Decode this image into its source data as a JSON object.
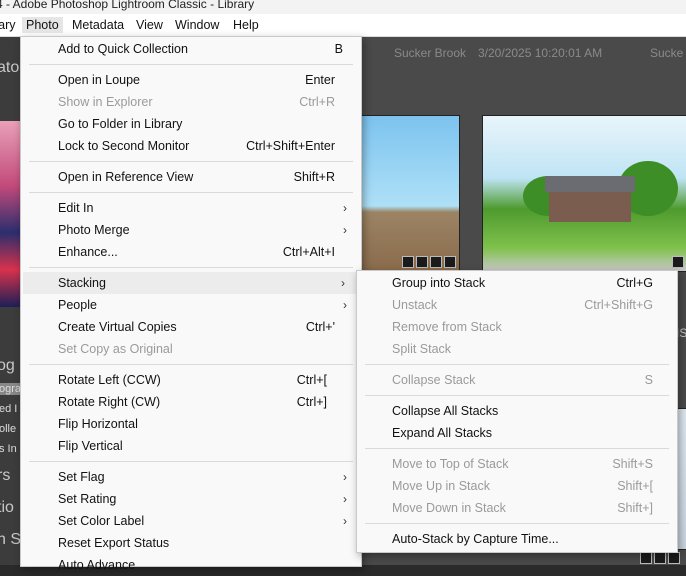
{
  "window": {
    "title": "4 - Adobe Photoshop Lightroom Classic - Library"
  },
  "menubar": {
    "items": [
      {
        "label": "rary"
      },
      {
        "label": "Photo"
      },
      {
        "label": "Metadata"
      },
      {
        "label": "View"
      },
      {
        "label": "Window"
      },
      {
        "label": "Help"
      }
    ]
  },
  "background": {
    "left_panel_texts": [
      "ato",
      "og",
      "ogra",
      "ed I",
      "olle",
      "s In",
      "rs",
      "tio",
      "h S"
    ],
    "grid_headers": [
      "Sucker Brook",
      "3/20/2025 10:20:01 AM",
      "Sucke"
    ],
    "right_edge_text": "IS"
  },
  "photo_menu": {
    "items": [
      {
        "label": "Add to Quick Collection",
        "shortcut": "B"
      },
      {
        "label": "Open in Loupe",
        "shortcut": "Enter"
      },
      {
        "label": "Show in Explorer",
        "shortcut": "Ctrl+R"
      },
      {
        "label": "Go to Folder in Library",
        "shortcut": ""
      },
      {
        "label": "Lock to Second Monitor",
        "shortcut": "Ctrl+Shift+Enter"
      },
      {
        "label": "Open in Reference View",
        "shortcut": "Shift+R"
      },
      {
        "label": "Edit In",
        "shortcut": ""
      },
      {
        "label": "Photo Merge",
        "shortcut": ""
      },
      {
        "label": "Enhance...",
        "shortcut": "Ctrl+Alt+I"
      },
      {
        "label": "Stacking",
        "shortcut": ""
      },
      {
        "label": "People",
        "shortcut": ""
      },
      {
        "label": "Create Virtual Copies",
        "shortcut": "Ctrl+'"
      },
      {
        "label": "Set Copy as Original",
        "shortcut": ""
      },
      {
        "label": "Rotate Left (CCW)",
        "shortcut": "Ctrl+["
      },
      {
        "label": "Rotate Right (CW)",
        "shortcut": "Ctrl+]"
      },
      {
        "label": "Flip Horizontal",
        "shortcut": ""
      },
      {
        "label": "Flip Vertical",
        "shortcut": ""
      },
      {
        "label": "Set Flag",
        "shortcut": ""
      },
      {
        "label": "Set Rating",
        "shortcut": ""
      },
      {
        "label": "Set Color Label",
        "shortcut": ""
      },
      {
        "label": "Reset Export Status",
        "shortcut": ""
      },
      {
        "label": "Auto Advance",
        "shortcut": ""
      }
    ],
    "submenu_arrow": "›"
  },
  "stacking_menu": {
    "items": [
      {
        "label": "Group into Stack",
        "shortcut": "Ctrl+G"
      },
      {
        "label": "Unstack",
        "shortcut": "Ctrl+Shift+G"
      },
      {
        "label": "Remove from Stack",
        "shortcut": ""
      },
      {
        "label": "Split Stack",
        "shortcut": ""
      },
      {
        "label": "Collapse Stack",
        "shortcut": "S"
      },
      {
        "label": "Collapse All Stacks",
        "shortcut": ""
      },
      {
        "label": "Expand All Stacks",
        "shortcut": ""
      },
      {
        "label": "Move to Top of Stack",
        "shortcut": "Shift+S"
      },
      {
        "label": "Move Up in Stack",
        "shortcut": "Shift+["
      },
      {
        "label": "Move Down in Stack",
        "shortcut": "Shift+]"
      },
      {
        "label": "Auto-Stack by Capture Time...",
        "shortcut": ""
      }
    ]
  }
}
